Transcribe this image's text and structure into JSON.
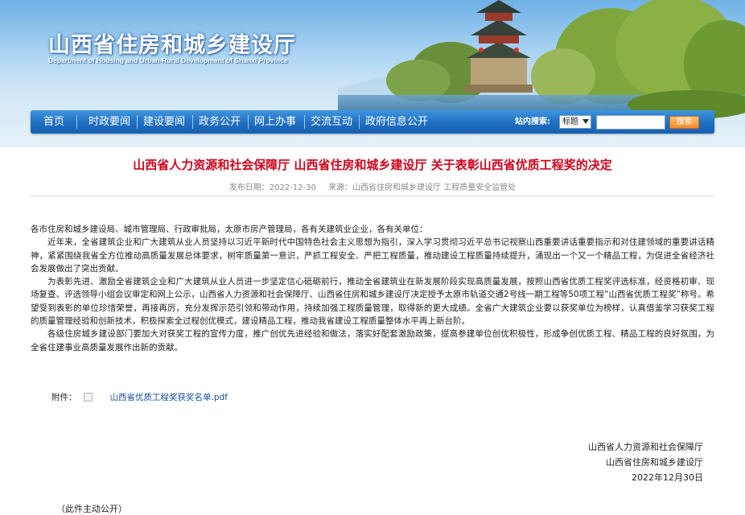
{
  "header": {
    "title": "山西省住房和城乡建设厅",
    "subtitle": "Department of Housing and Urban-Rural Development of Shanxi Province"
  },
  "nav": {
    "items": [
      "首页",
      "时政要闻",
      "建设要闻",
      "政务公开",
      "网上办事",
      "交流互动",
      "政府信息公开"
    ],
    "search_label": "站内搜索:",
    "search_option": "标题",
    "search_button": "搜索"
  },
  "article": {
    "title": "山西省人力资源和社会保障厅 山西省住房和城乡建设厅 关于表彰山西省优质工程奖的决定",
    "date_label": "发布日期：",
    "date": "2022-12-30",
    "source_label": "来源：",
    "source": "山西省住房和城乡建设厅 工程质量安全监管处",
    "paragraphs": [
      "各市住房和城乡建设局、城市管理局、行政审批局，太原市房产管理局，各有关建筑业企业，各有关单位：",
      "近年来，全省建筑企业和广大建筑从业人员坚持以习近平新时代中国特色社会主义思想为指引，深入学习贯彻习近平总书记视察山西重要讲话重要指示和对住建领域的重要讲话精神，紧紧围绕我省全方位推动高质量发展总体要求，树牢质量第一意识，严抓工程安全、严把工程质量，推动建设工程质量持续提升，涌现出一个又一个精品工程，为促进全省经济社会发展做出了突出贡献。",
      "为表彰先进、激励全省建筑企业和广大建筑从业人员进一步坚定信心砥砺前行，推动全省建筑业在新发展阶段实现高质量发展，按照山西省优质工程奖评选标准，经资格初审、现场复查、评选领导小组会议审定和网上公示，山西省人力资源和社会保障厅、山西省住房和城乡建设厅决定授予太原市轨道交通2号线一期工程等50项工程“山西省优质工程奖”称号。希望受到表彰的单位珍惜荣誉，再接再厉，充分发挥示范引领和带动作用，持续加强工程质量管理，取得新的更大成绩。全省广大建筑企业要以获奖单位为榜样，认真借鉴学习获奖工程的质量管理经验和创新技术，积极探索全过程创优模式，建设精品工程，推动我省建设工程质量整体水平再上新台阶。",
      "各级住房城乡建设部门要加大对获奖工程的宣传力度，推广创优先进经验和做法，落实好配套激励政策，提高参建单位创优积极性，形成争创优质工程、精品工程的良好氛围，为全省住建事业高质量发展作出新的贡献。"
    ],
    "attachment_label": "附件：",
    "attachment_file": "山西省优质工程奖获奖名单.pdf",
    "signature": [
      "山西省人力资源和社会保障厅",
      "山西省住房和城乡建设厅",
      "2022年12月30日"
    ],
    "note": "（此件主动公开）"
  },
  "colors": {
    "nav_blue": "#1f6ec2",
    "title_red": "#d0021b",
    "link_blue": "#1a4fa0",
    "search_orange": "#f08a2c"
  }
}
